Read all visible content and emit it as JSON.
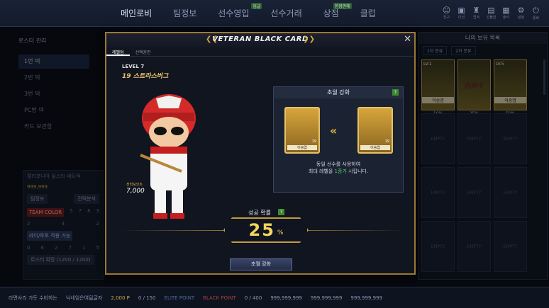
{
  "topnav": {
    "items": [
      {
        "label": "메인로비"
      },
      {
        "label": "팀정보"
      },
      {
        "label": "선수영입",
        "badge": "업글"
      },
      {
        "label": "선수거래"
      },
      {
        "label": "상점",
        "badge": "한정판매"
      },
      {
        "label": "클럽"
      }
    ],
    "icons": [
      {
        "icon": "friend-icon",
        "label": "친구"
      },
      {
        "label": "미션",
        "icon": "mission-icon"
      },
      {
        "label": "업적",
        "icon": "trophy-icon"
      },
      {
        "label": "선물함",
        "icon": "gift-icon"
      },
      {
        "label": "출석",
        "icon": "calendar-icon"
      },
      {
        "label": "설정",
        "icon": "gear-icon"
      },
      {
        "label": "종료",
        "icon": "power-icon"
      }
    ]
  },
  "sidebar": {
    "title": "로스터 관리",
    "items": [
      "1번 덱",
      "2번 덱",
      "3번 덱",
      "PC방 덱",
      "카드 보관함"
    ]
  },
  "left_card": {
    "team": "캘리포니아 올스타 세트덱",
    "value": "999,999",
    "btn1": "팀정보",
    "btn2": "전력분석",
    "team_color": "TEAM COLOR",
    "nums_a": [
      "5",
      "7",
      "8",
      "3"
    ],
    "nums_b": [
      "2",
      "4",
      "2"
    ],
    "tag2": "레이/토토 적용 가능",
    "nums_c": [
      "0",
      "6",
      "2",
      "7",
      "1",
      "5"
    ],
    "roster": "로스터 확장 (1200 / 1200)"
  },
  "modal": {
    "title": "VETERAN BLACK CARD",
    "tabs": [
      "레벨업",
      "선택훈련"
    ],
    "level": "LEVEL 7",
    "card_name": "19 스트라스버그",
    "power_label": "전력포인트",
    "power_value": "7,000",
    "upgrade": {
      "title": "초월 강화",
      "card_left_name": "이승엽",
      "card_right_name": "이승엽",
      "card_left_num": "19",
      "card_right_num": "19",
      "desc_line1": "동일 선수를 사용하여",
      "desc_line2_pre": "최대 레벨을 ",
      "desc_highlight": "1증가",
      "desc_line2_post": " 시킵니다."
    },
    "prob_label": "성공 확률",
    "prob_value": "25",
    "prob_unit": "%",
    "button": "초월 강화"
  },
  "rightpanel": {
    "title": "나의 보유 목록",
    "filters": [
      "1차 분류",
      "2차 분류"
    ],
    "slots": [
      {
        "name": "이승엽",
        "pct": "10%",
        "filled": true,
        "lv": "LV.1"
      },
      {
        "name": "",
        "pct": "25%",
        "filled": true,
        "lock": "选择中"
      },
      {
        "name": "이승엽",
        "pct": "50%",
        "filled": true,
        "lv": "LV.5"
      },
      {
        "name": "EMPTY",
        "filled": false
      },
      {
        "name": "EMPTY",
        "filled": false
      },
      {
        "name": "EMPTY",
        "filled": false
      },
      {
        "name": "EMPTY",
        "filled": false
      },
      {
        "name": "EMPTY",
        "filled": false
      },
      {
        "name": "EMPTY",
        "filled": false
      },
      {
        "name": "EMPTY",
        "filled": false
      },
      {
        "name": "EMPTY",
        "filled": false
      },
      {
        "name": "EMPTY",
        "filled": false
      }
    ]
  },
  "bottombar": {
    "msg": "라면사리 가듯 수비하는",
    "nick": "닉네임은여덟글자",
    "points": "2,000 P",
    "elite": "0 / 150",
    "elite_label": "ELITE POINT",
    "black_label": "BLACK POINT",
    "black": "0 / 400",
    "g1": "999,999,999",
    "g2": "999,999,999",
    "g3": "999,999,999"
  }
}
